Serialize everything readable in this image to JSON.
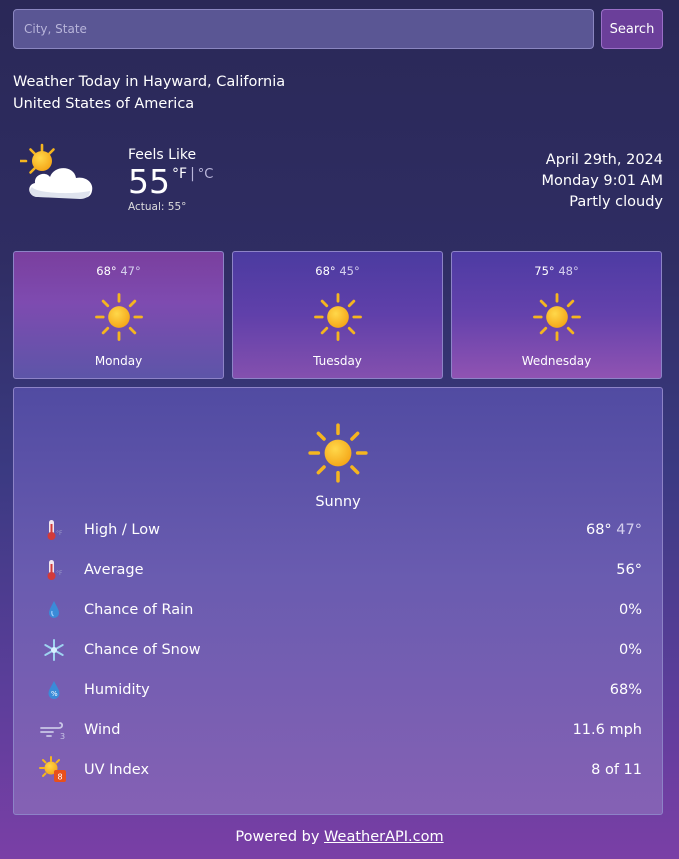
{
  "search": {
    "placeholder": "City, State",
    "value": "",
    "button_label": "Search"
  },
  "location": {
    "line1": "Weather Today in Hayward, California",
    "line2": "United States of America"
  },
  "current": {
    "feels_like_label": "Feels Like",
    "temp": "55",
    "unit_f": "°F",
    "unit_sep": "|",
    "unit_c": "°C",
    "actual": "Actual: 55°",
    "icon": "partly-cloudy-icon"
  },
  "datetime": {
    "date": "April 29th, 2024",
    "day": "Monday",
    "time": "9:01 AM",
    "condition": "Partly cloudy"
  },
  "forecast": [
    {
      "high": "68°",
      "low": "47°",
      "day": "Monday",
      "icon": "sun-icon"
    },
    {
      "high": "68°",
      "low": "45°",
      "day": "Tuesday",
      "icon": "sun-icon"
    },
    {
      "high": "75°",
      "low": "48°",
      "day": "Wednesday",
      "icon": "sun-icon"
    }
  ],
  "detail": {
    "condition": "Sunny",
    "rows": [
      {
        "label": "High / Low",
        "value": "68°",
        "value_low": "47°",
        "icon": "thermometer-icon"
      },
      {
        "label": "Average",
        "value": "56°",
        "icon": "thermometer-icon"
      },
      {
        "label": "Chance of Rain",
        "value": "0%",
        "icon": "raindrop-icon"
      },
      {
        "label": "Chance of Snow",
        "value": "0%",
        "icon": "snowflake-icon"
      },
      {
        "label": "Humidity",
        "value": "68%",
        "icon": "humidity-icon"
      },
      {
        "label": "Wind",
        "value": "11.6 mph",
        "icon": "wind-icon",
        "icon_text": "3"
      },
      {
        "label": "UV Index",
        "value": "8 of 11",
        "icon": "uv-index-icon",
        "icon_text": "8"
      }
    ]
  },
  "footer": {
    "prefix": "Powered by ",
    "link": "WeatherAPI.com"
  },
  "colors": {
    "sun": "#f7b824",
    "sun_ray": "#f5b51f",
    "uv_badge": "#e8501b",
    "raindrop": "#3a8bd8"
  }
}
